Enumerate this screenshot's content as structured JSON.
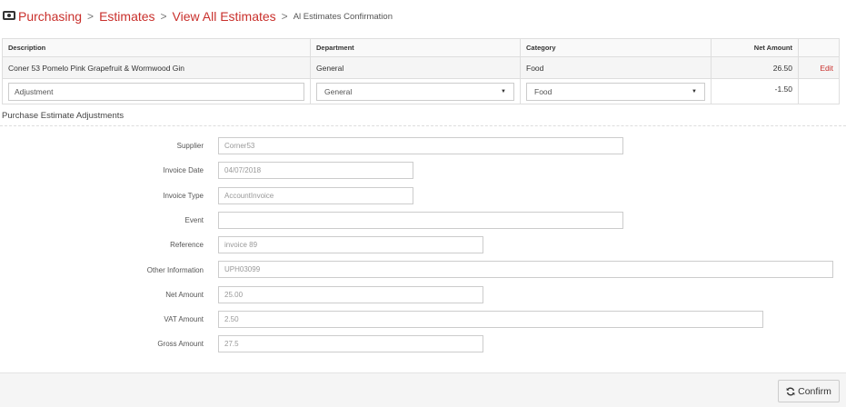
{
  "breadcrumb": {
    "items": [
      "Purchasing",
      "Estimates",
      "View All Estimates"
    ],
    "separator": ">",
    "current": "Al Estimates Confirmation"
  },
  "table": {
    "headers": {
      "description": "Description",
      "department": "Department",
      "category": "Category",
      "net_amount": "Net Amount"
    },
    "row": {
      "description": "Coner 53 Pomelo Pink Grapefruit & Wormwood Gin",
      "department": "General",
      "category": "Food",
      "net_amount": "26.50",
      "action": "Edit"
    },
    "adjustment": {
      "description": "Adjustment",
      "department": "General",
      "category": "Food",
      "net_amount": "-1.50"
    }
  },
  "section": {
    "title": "Purchase Estimate Adjustments"
  },
  "form": {
    "supplier": {
      "label": "Supplier",
      "value": "Corner53"
    },
    "invoice_date": {
      "label": "Invoice Date",
      "value": "04/07/2018"
    },
    "invoice_type": {
      "label": "Invoice Type",
      "value": "AccountInvoice"
    },
    "event": {
      "label": "Event",
      "value": ""
    },
    "reference": {
      "label": "Reference",
      "value": "invoice 89"
    },
    "other_information": {
      "label": "Other Information",
      "value": "UPH03099"
    },
    "net_amount": {
      "label": "Net Amount",
      "value": "25.00"
    },
    "vat_amount": {
      "label": "VAT Amount",
      "value": "2.50"
    },
    "gross_amount": {
      "label": "Gross Amount",
      "value": "27.5"
    }
  },
  "footer": {
    "confirm_label": "Confirm",
    "confirm_icon": "refresh-icon"
  },
  "colors": {
    "accent": "#c9302c"
  }
}
